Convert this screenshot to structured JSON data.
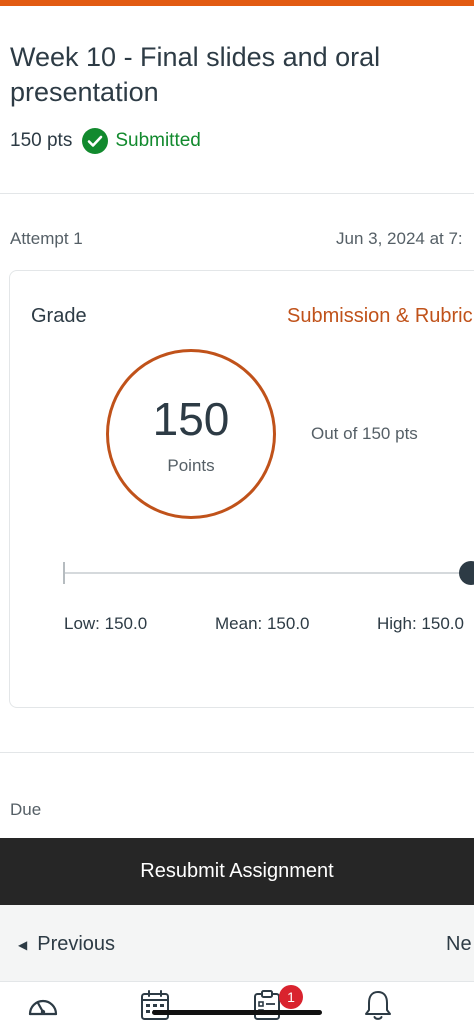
{
  "assignment": {
    "title": "Week 10 - Final slides and oral presentation",
    "points": "150 pts",
    "status": "Submitted"
  },
  "attempt": {
    "label": "Attempt 1",
    "date": "Jun 3, 2024 at 7:"
  },
  "grade": {
    "label": "Grade",
    "submission_link": "Submission & Rubric",
    "score": "150",
    "score_unit": "Points",
    "out_of": "Out of 150 pts",
    "score_fraction": 1.0,
    "stats": {
      "low": "Low: 150.0",
      "mean": "Mean: 150.0",
      "high": "High: 150.0"
    }
  },
  "due": {
    "label": "Due"
  },
  "actions": {
    "resubmit": "Resubmit Assignment"
  },
  "navigation": {
    "previous": "Previous",
    "next": "Ne"
  },
  "tabbar": {
    "items": [
      "dashboard-icon",
      "calendar-icon",
      "todo-icon",
      "notifications-icon"
    ],
    "todo_badge": "1"
  },
  "colors": {
    "accent": "#e25b12",
    "rust": "#c0521a",
    "success": "#128a2e",
    "dark_button": "#262626",
    "badge": "#d9232e"
  }
}
